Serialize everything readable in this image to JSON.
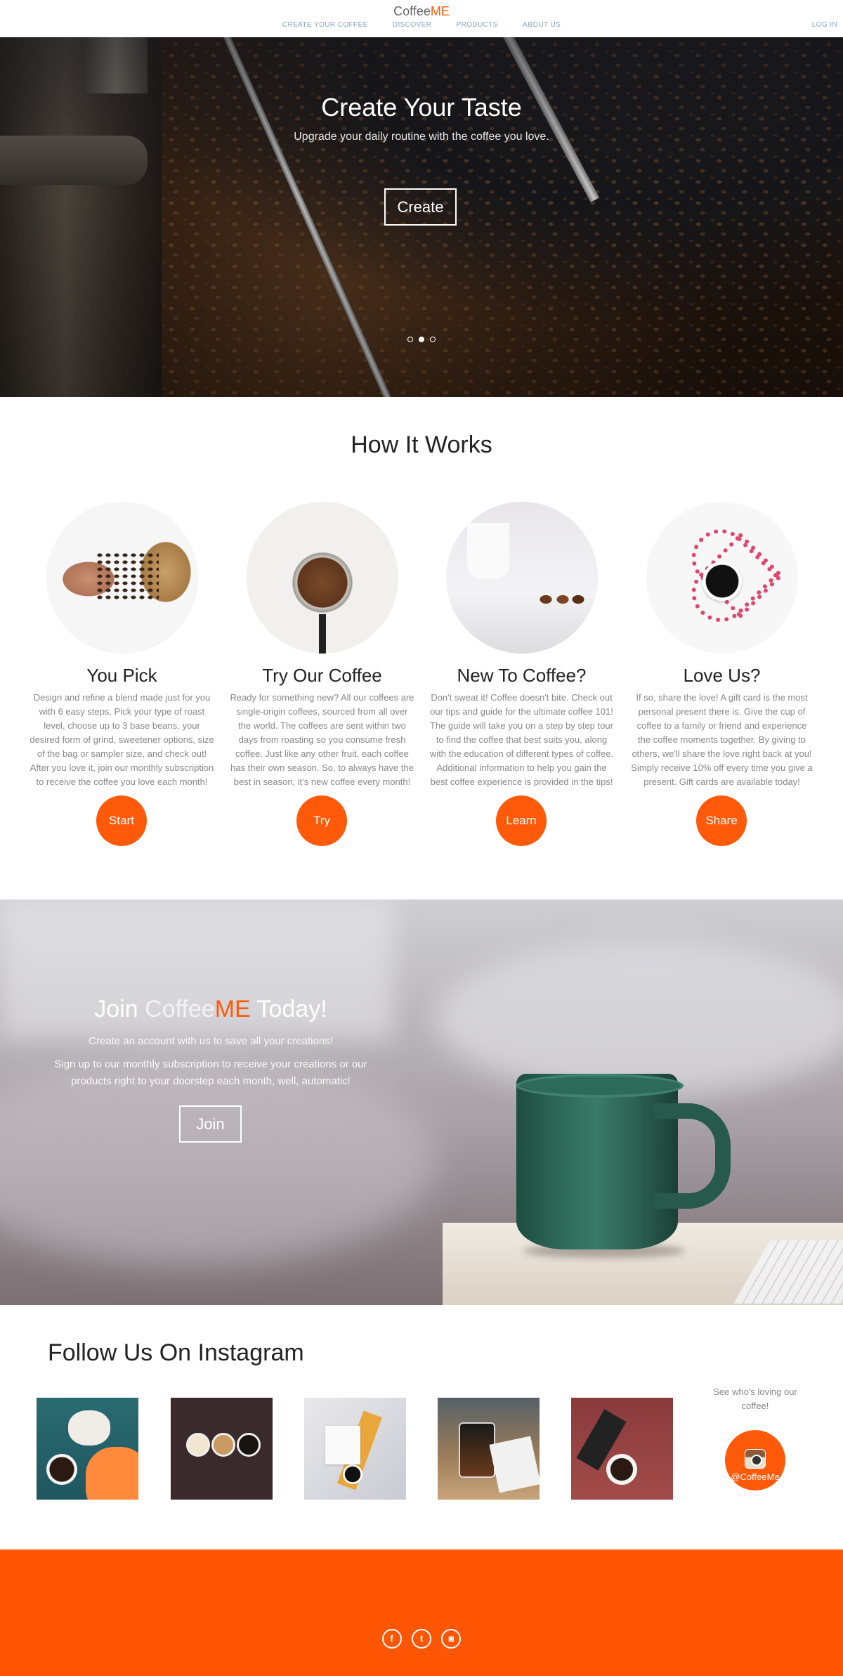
{
  "header": {
    "logo_prefix": "Coffee",
    "logo_suffix": "ME",
    "nav": [
      "CREATE YOUR COFFEE",
      "DISCOVER",
      "PRODUCTS",
      "ABOUT US"
    ],
    "login": "LOG IN"
  },
  "hero": {
    "title": "Create Your Taste",
    "subtitle": "Upgrade your daily routine with the coffee you love.",
    "button": "Create",
    "slides": 3,
    "active_slide": 2
  },
  "how": {
    "title": "How It Works",
    "cards": [
      {
        "title": "You Pick",
        "text": "Design and refine a blend made just for you with 6 easy steps. Pick your type of roast level, choose up to 3 base beans, your desired form of grind, sweetener options, size of the bag or sampler size, and check out! After you love it, join our monthly subscription to receive the coffee you love each month!",
        "button": "Start"
      },
      {
        "title": "Try Our Coffee",
        "text": "Ready for something new? All our coffees are single-origin coffees, sourced from all over the world. The coffees are sent within two days from roasting so you consume fresh coffee. Just like any other fruit, each coffee has their own season. So, to always have the best in season, it's new coffee every month!",
        "button": "Try"
      },
      {
        "title": "New To Coffee?",
        "text": "Don't sweat it! Coffee doesn't bite. Check out our tips and guide for the ultimate coffee 101! The guide will take you on a step by step tour to find the coffee that best suits you, along with the education of different types of coffee. Additional information to help you gain the best coffee experience is provided in the tips!",
        "button": "Learn"
      },
      {
        "title": "Love Us?",
        "text": "If so, share the love! A gift card is the most personal present there is. Give the cup of coffee to a family or friend and experience the coffee moments together. By giving to others, we'll share the love right back at you! Simply receive 10% off every time you give a present. Gift cards are available today!",
        "button": "Share"
      }
    ]
  },
  "join": {
    "title_prefix": "Join ",
    "title_brand": "Coffee",
    "title_brand_me": "ME",
    "title_suffix": " Today!",
    "line1": "Create an account with us to save all your creations!",
    "line2": "Sign up to our monthly subscription to receive your creations or our products right to your doorstep each month, well, automatic!",
    "button": "Join"
  },
  "instagram": {
    "title": "Follow Us On Instagram",
    "side_text": "See who's loving our coffee!",
    "handle": "@CoffeeMe"
  },
  "footer": {
    "social": [
      "facebook-icon",
      "twitter-icon",
      "instagram-icon"
    ],
    "social_glyphs": [
      "f",
      "t",
      "◙"
    ]
  },
  "colors": {
    "accent": "#ff5a0a",
    "footer": "#ff5605",
    "nav_text": "#8aa3b8"
  }
}
